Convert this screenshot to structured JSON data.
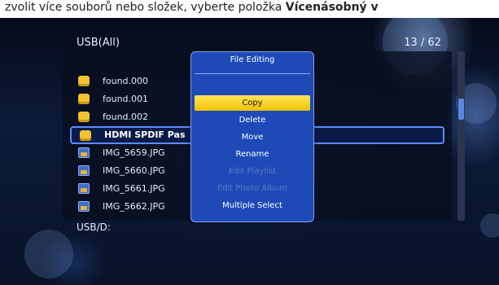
{
  "caption": {
    "text_before": "zvolit více souborů nebo složek, vyberte položka ",
    "bold_text": "Vícenásobný v"
  },
  "browser": {
    "title": "USB(All)",
    "count": "13 / 62",
    "current_path": "USB/D:",
    "items": [
      {
        "label": "found.000",
        "icon": "folder-icon"
      },
      {
        "label": "found.001",
        "icon": "folder-icon"
      },
      {
        "label": "found.002",
        "icon": "folder-icon"
      },
      {
        "label": "HDMI SPDIF Pas",
        "icon": "folder-icon",
        "selected": true
      },
      {
        "label": "IMG_5659.JPG",
        "icon": "image-icon"
      },
      {
        "label": "IMG_5660.JPG",
        "icon": "image-icon"
      },
      {
        "label": "IMG_5661.JPG",
        "icon": "image-icon"
      },
      {
        "label": "IMG_5662.JPG",
        "icon": "image-icon"
      }
    ]
  },
  "menu": {
    "title": "File Editing",
    "items": [
      {
        "label": "Copy",
        "state": "active"
      },
      {
        "label": "Delete",
        "state": "enabled"
      },
      {
        "label": "Move",
        "state": "enabled"
      },
      {
        "label": "Rename",
        "state": "enabled"
      },
      {
        "label": "Edit Playlist",
        "state": "disabled"
      },
      {
        "label": "Edit Photo Album",
        "state": "disabled"
      },
      {
        "label": "Multiple Select",
        "state": "enabled"
      }
    ]
  },
  "colors": {
    "highlight": "#f2c200",
    "menu_bg": "#1e4ab8",
    "selection_border": "#5d8cff"
  }
}
